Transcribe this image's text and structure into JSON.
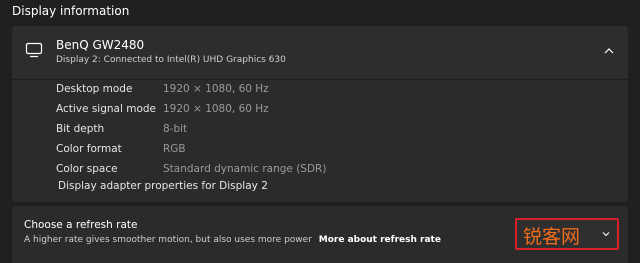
{
  "section": {
    "title": "Display information"
  },
  "monitor": {
    "icon": "monitor-icon",
    "name": "BenQ GW2480",
    "description": "Display 2: Connected to Intel(R) UHD Graphics 630",
    "expanded": true
  },
  "details": [
    {
      "label": "Desktop mode",
      "value": "1920 × 1080, 60 Hz"
    },
    {
      "label": "Active signal mode",
      "value": "1920 × 1080, 60 Hz"
    },
    {
      "label": "Bit depth",
      "value": "8-bit"
    },
    {
      "label": "Color format",
      "value": "RGB"
    },
    {
      "label": "Color space",
      "value": "Standard dynamic range (SDR)"
    }
  ],
  "adapter_link": "Display adapter properties for Display 2",
  "refresh": {
    "title": "Choose a refresh rate",
    "description": "A higher rate gives smoother motion, but also uses more power",
    "link": "More about refresh rate",
    "dropdown_value": "",
    "watermark": "锐客网"
  },
  "colors": {
    "background": "#202020",
    "card": "#2b2b2b",
    "highlight_box": "#d8202a",
    "watermark": "#ef6c1a"
  }
}
